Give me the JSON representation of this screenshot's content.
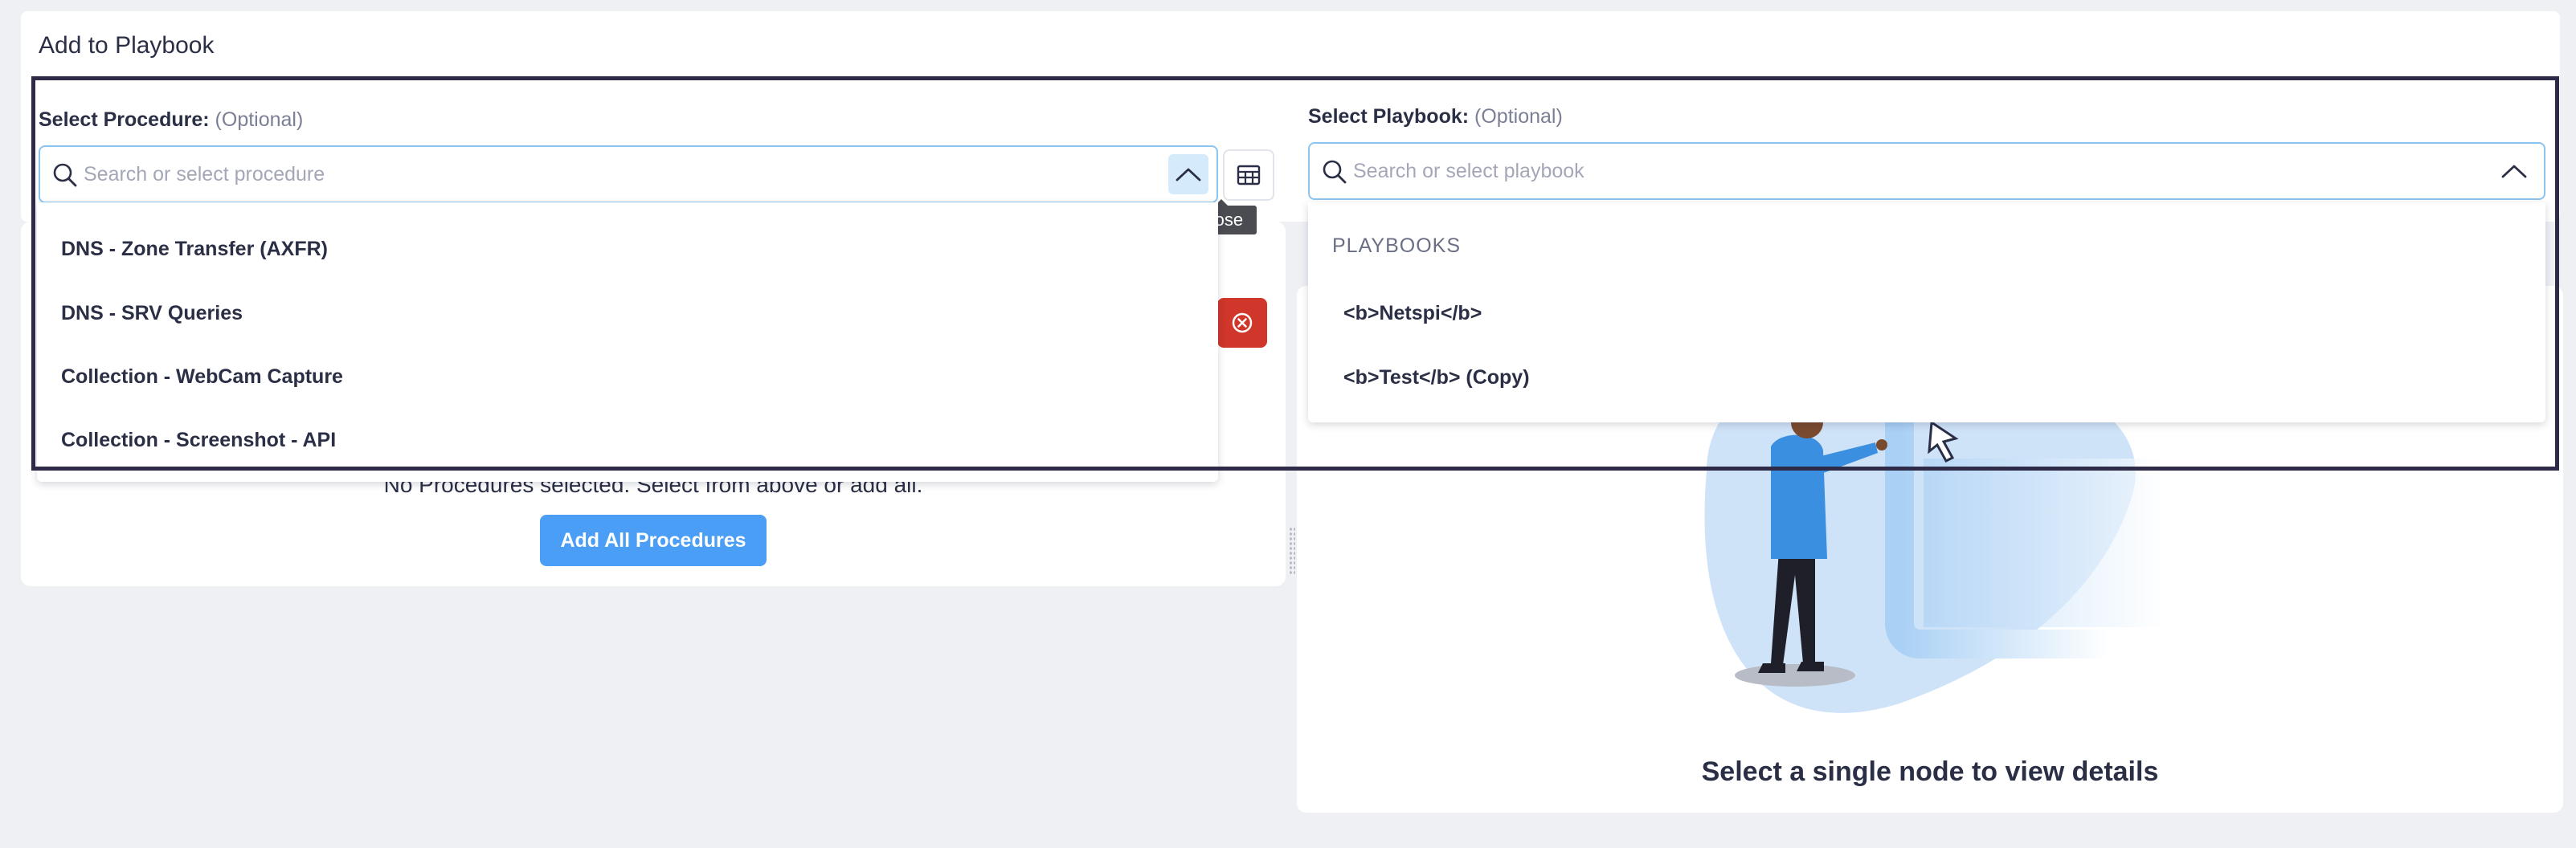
{
  "page": {
    "title": "Add to Playbook"
  },
  "procedure_select": {
    "label": "Select Procedure:",
    "optional": "(Optional)",
    "placeholder": "Search or select procedure",
    "toggle_tooltip": "Close",
    "options": [
      "DNS - Zone Transfer (AXFR)",
      "DNS - SRV Queries",
      "Collection - WebCam Capture",
      "Collection - Screenshot - API"
    ]
  },
  "playbook_select": {
    "label": "Select Playbook:",
    "optional": "(Optional)",
    "placeholder": "Search or select playbook",
    "group_header": "PLAYBOOKS",
    "options": [
      "<b>Netspi</b>",
      "<b>Test</b> (Copy)"
    ]
  },
  "procedures_panel": {
    "empty_message": "No Procedures selected. Select from above or add all.",
    "add_all_label": "Add All Procedures"
  },
  "details_panel": {
    "hint": "Select a single node to view details"
  },
  "colors": {
    "accent": "#4a9ef5",
    "danger": "#d0362a",
    "frame": "#2d2b47",
    "focus_border": "#8cc4f0"
  },
  "icons": {
    "search": "search-icon",
    "chevron": "chevron-up-icon",
    "table": "table-icon",
    "clear": "close-circle-icon"
  }
}
